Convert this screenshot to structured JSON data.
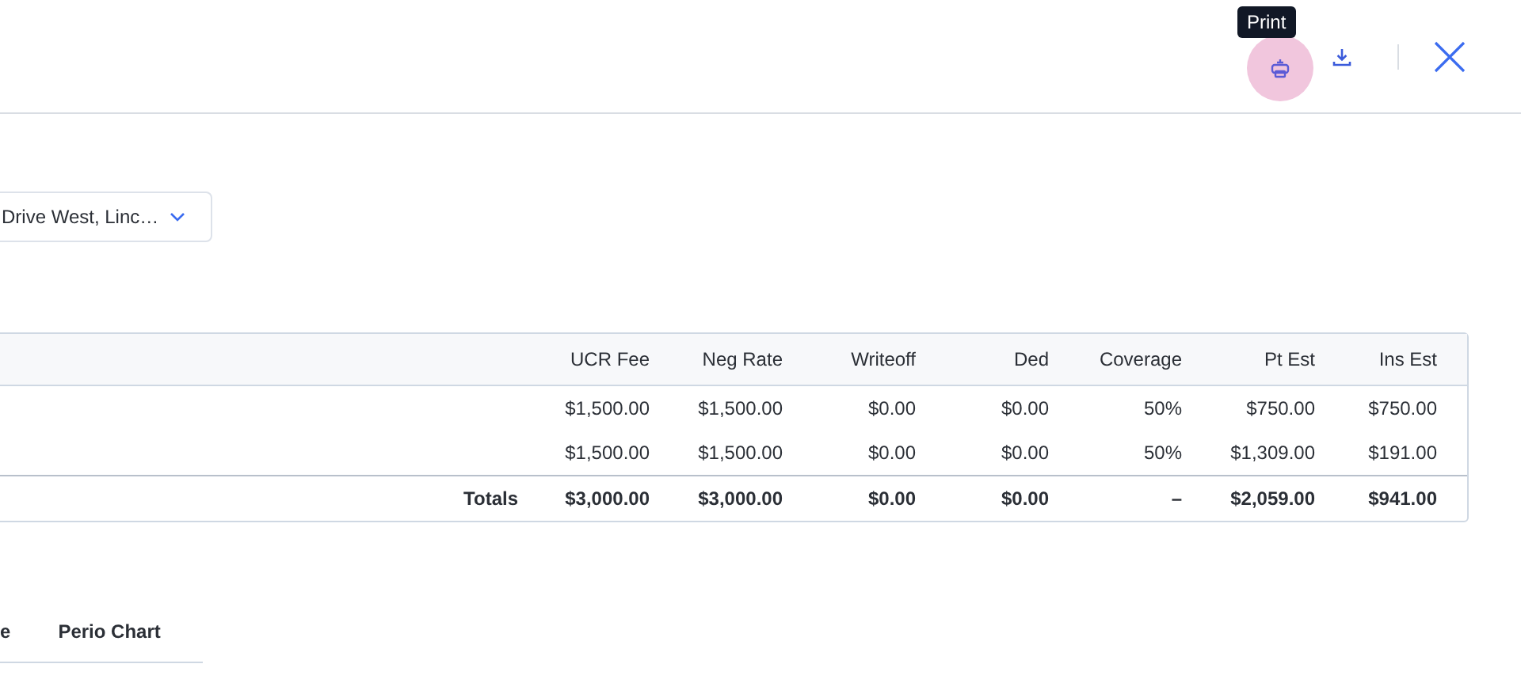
{
  "header": {
    "tooltip": "Print",
    "print_hovered": true
  },
  "location_select": {
    "value": "Drive West, Linc…"
  },
  "table": {
    "columns": [
      "",
      "UCR Fee",
      "Neg Rate",
      "Writeoff",
      "Ded",
      "Coverage",
      "Pt Est",
      "Ins Est"
    ],
    "rows": [
      [
        "",
        "$1,500.00",
        "$1,500.00",
        "$0.00",
        "$0.00",
        "50%",
        "$750.00",
        "$750.00"
      ],
      [
        "",
        "$1,500.00",
        "$1,500.00",
        "$0.00",
        "$0.00",
        "50%",
        "$1,309.00",
        "$191.00"
      ]
    ],
    "totals": [
      "Totals",
      "$3,000.00",
      "$3,000.00",
      "$0.00",
      "$0.00",
      "–",
      "$2,059.00",
      "$941.00"
    ]
  },
  "tabs": [
    {
      "label": "e",
      "selected": false
    },
    {
      "label": "Perio Chart",
      "selected": false
    }
  ]
}
